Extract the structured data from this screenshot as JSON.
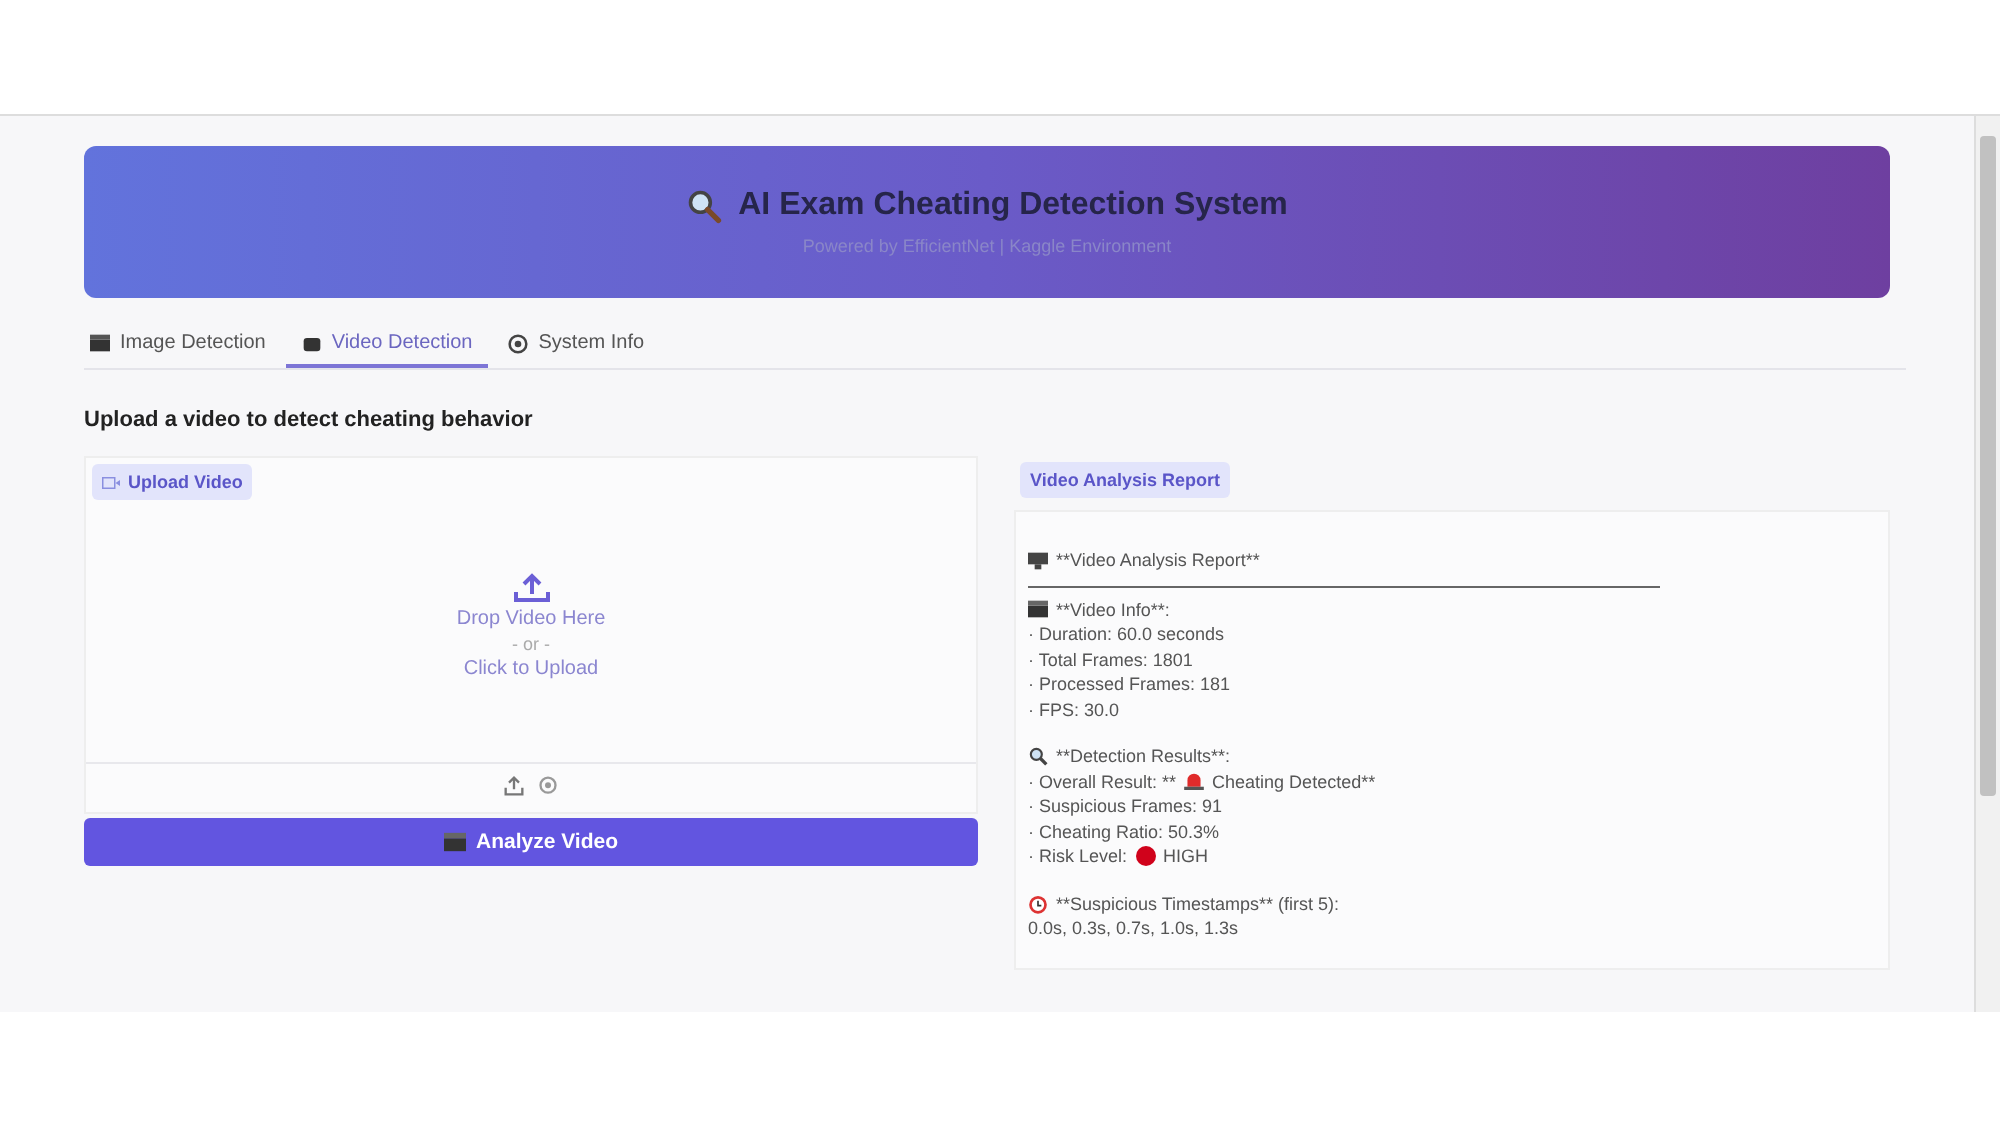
{
  "header": {
    "title": "AI Exam Cheating Detection System",
    "subtitle": "Powered by EfficientNet | Kaggle Environment"
  },
  "tabs": [
    {
      "label": "Image Detection",
      "selected": false
    },
    {
      "label": "Video Detection",
      "selected": true
    },
    {
      "label": "System Info",
      "selected": false
    }
  ],
  "instruction": "Upload a video to detect cheating behavior",
  "upload": {
    "label": "Upload Video",
    "drop_text": "Drop Video Here",
    "or_text": "- or -",
    "click_text": "Click to Upload"
  },
  "analyze_button": "Analyze Video",
  "report": {
    "label": "Video Analysis Report",
    "title": "**Video Analysis Report**",
    "sections": [
      {
        "heading": "**Video Info**:",
        "lines": [
          {
            "text": "· Duration: 60.0 seconds"
          },
          {
            "text": "· Total Frames: 1801"
          },
          {
            "text": "· Processed Frames: 181"
          },
          {
            "text": "· FPS: 30.0"
          }
        ]
      },
      {
        "heading": "**Detection Results**:",
        "lines": [
          {
            "text": "· Overall Result: **",
            "kind": "alert",
            "after": "Cheating Detected**"
          },
          {
            "text": "· Suspicious Frames: 91"
          },
          {
            "text": "· Cheating Ratio: 50.3%"
          },
          {
            "text": "· Risk Level:",
            "kind": "dot",
            "after": "HIGH"
          }
        ]
      },
      {
        "heading": "**Suspicious Timestamps** (first 5):",
        "lines": [
          {
            "text": "0.0s, 0.3s, 0.7s, 1.0s, 1.3s"
          }
        ]
      }
    ]
  }
}
